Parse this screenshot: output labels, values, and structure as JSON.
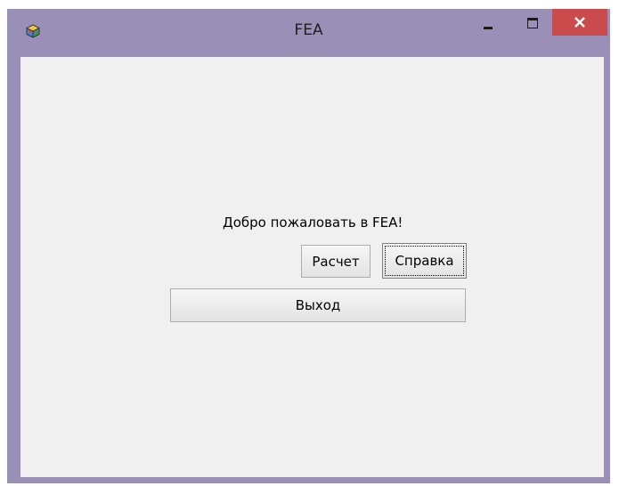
{
  "window": {
    "title": "FEA",
    "controls": {
      "minimize": "minimize-icon",
      "maximize": "maximize-icon",
      "close": "close-icon"
    },
    "colors": {
      "frame": "#9a8fb6",
      "close": "#c94b4b",
      "client": "#f0f0f0"
    }
  },
  "main": {
    "welcome_text": "Добро пожаловать в FEA!",
    "calc_label": "Расчет",
    "help_label": "Справка",
    "exit_label": "Выход"
  }
}
